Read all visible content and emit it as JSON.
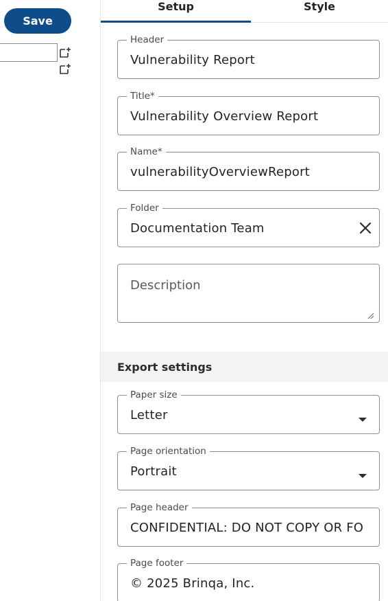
{
  "toolbar": {
    "save_label": "Save"
  },
  "tabs": [
    {
      "label": "Setup",
      "active": true
    },
    {
      "label": "Style",
      "active": false
    }
  ],
  "fields": {
    "header": {
      "label": "Header",
      "value": "Vulnerability Report"
    },
    "title": {
      "label": "Title*",
      "value": "Vulnerability Overview Report"
    },
    "name": {
      "label": "Name*",
      "value": "vulnerabilityOverviewReport"
    },
    "folder": {
      "label": "Folder",
      "value": "Documentation Team"
    },
    "description": {
      "placeholder": "Description"
    }
  },
  "export_settings": {
    "title": "Export settings",
    "paper_size": {
      "label": "Paper size",
      "value": "Letter"
    },
    "page_orientation": {
      "label": "Page orientation",
      "value": "Portrait"
    },
    "page_header": {
      "label": "Page header",
      "value": "CONFIDENTIAL: DO NOT COPY OR FO"
    },
    "page_footer": {
      "label": "Page footer",
      "value": "© 2025 Brinqa, Inc."
    }
  },
  "colors": {
    "accent": "#0f4d8a",
    "border": "#8f8f8f",
    "section_bg": "#f3f3f3"
  },
  "icons": [
    "add-box-icon",
    "clear-icon",
    "dropdown-arrow-icon",
    "resize-handle-icon"
  ]
}
